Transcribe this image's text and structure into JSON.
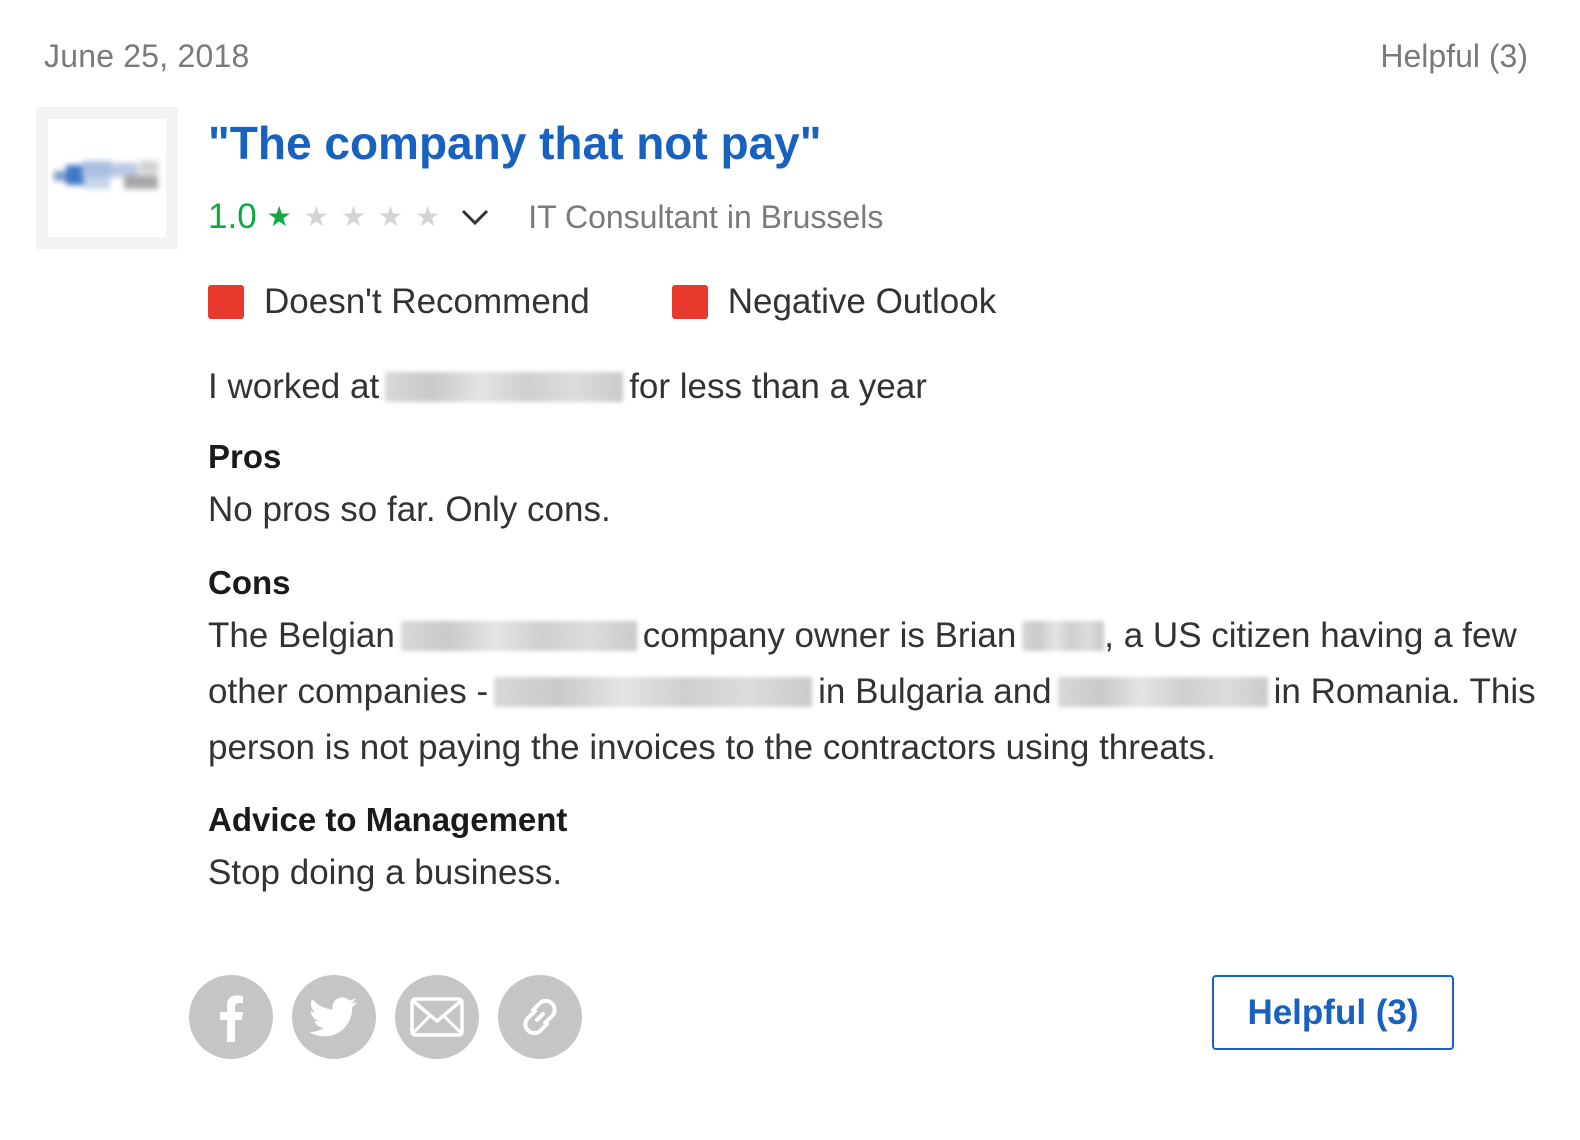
{
  "review": {
    "date": "June 25, 2018",
    "helpful_top": "Helpful (3)",
    "title": "\"The company that not pay\"",
    "rating_value": "1.0",
    "rating_stars": 1,
    "rating_max": 5,
    "job_title": "IT Consultant in Brussels",
    "flags": [
      {
        "label": "Doesn't Recommend",
        "color": "#e8392f"
      },
      {
        "label": "Negative Outlook",
        "color": "#e8392f"
      }
    ],
    "employment": {
      "before": "I worked at",
      "after": "for less than a year"
    },
    "pros": {
      "heading": "Pros",
      "text": "No pros so far. Only cons."
    },
    "cons": {
      "heading": "Cons",
      "line1_a": "The Belgian",
      "line1_b": "company owner is Brian",
      "line1_c": ", a US citizen having a few",
      "line2_a": "other companies -",
      "line2_b": "in Bulgaria and",
      "line2_c": "in Romania. This",
      "line3": "person is not paying the invoices to the contractors using threats."
    },
    "advice": {
      "heading": "Advice to Management",
      "text": "Stop doing a business."
    }
  },
  "share": {
    "icons": [
      "facebook-icon",
      "twitter-icon",
      "email-icon",
      "link-icon"
    ]
  },
  "helpful_button": {
    "label": "Helpful (3)"
  },
  "colors": {
    "title": "#1861bf",
    "rating": "#0caa41",
    "flag_negative": "#e8392f",
    "share_bg": "#c5c5c5"
  }
}
